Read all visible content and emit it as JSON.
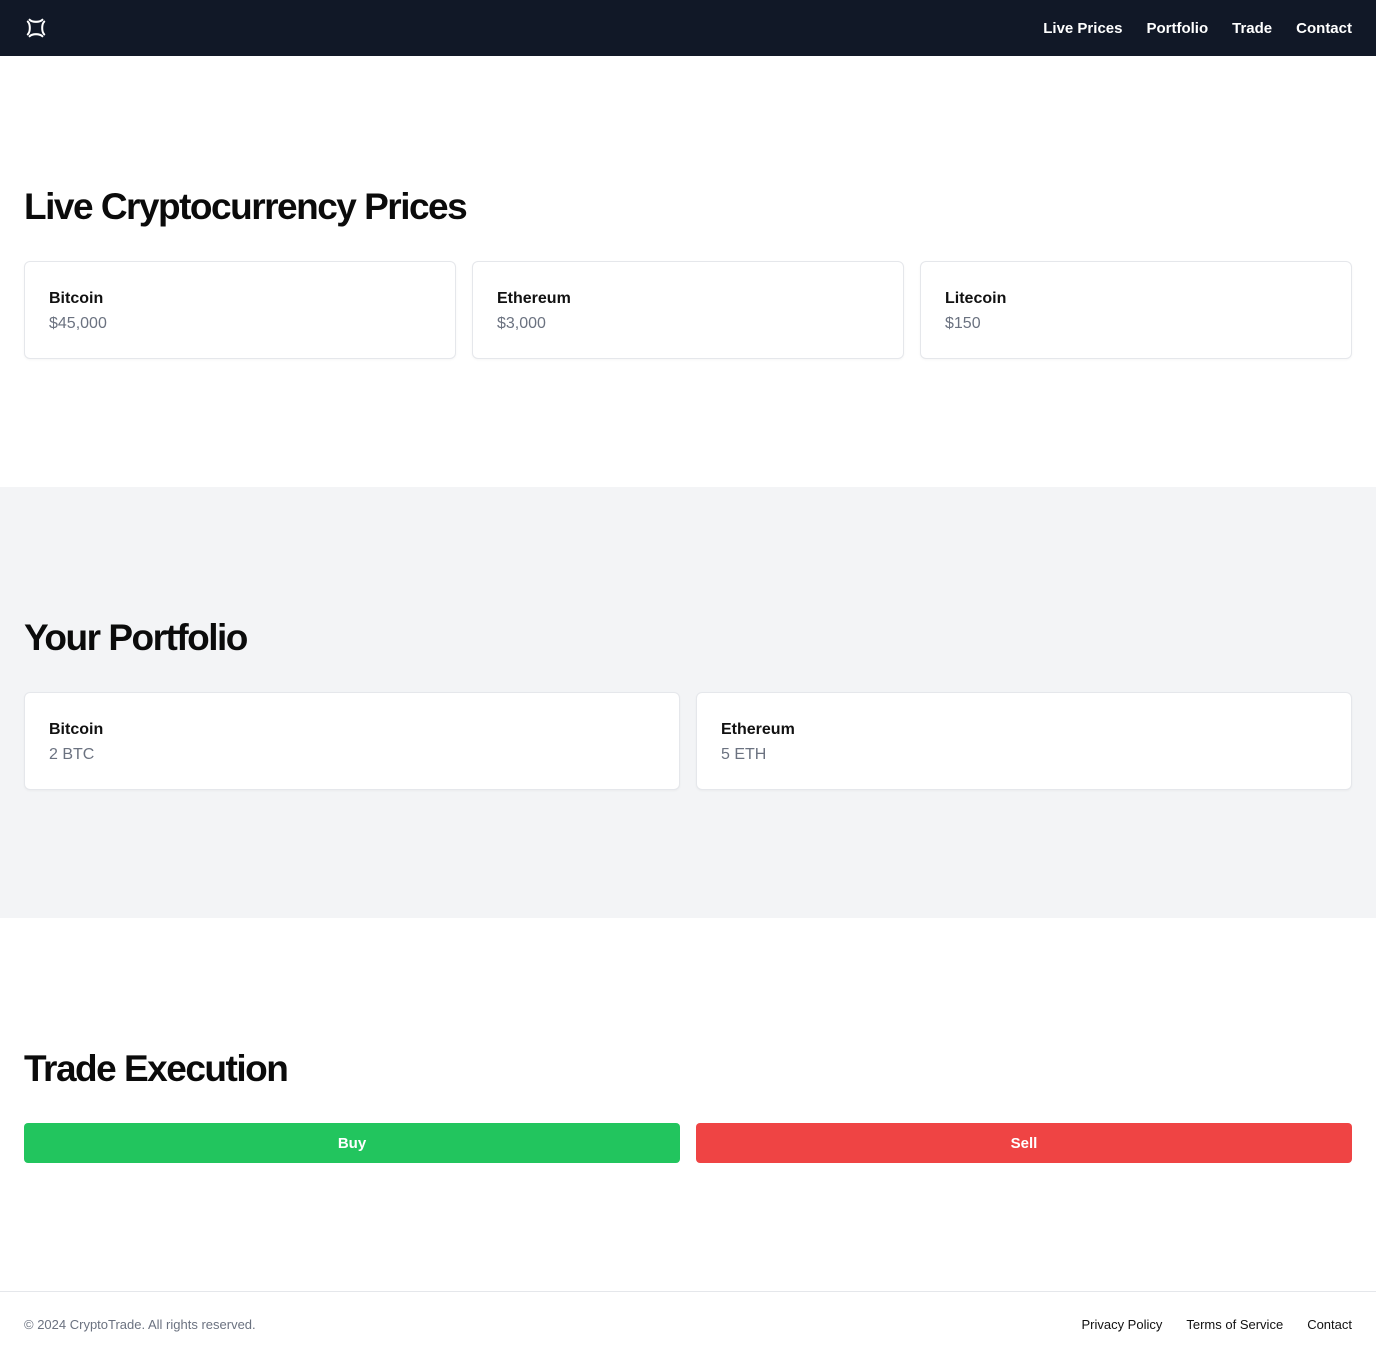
{
  "header": {
    "logo_icon": "brand-logo-icon",
    "nav": [
      {
        "label": "Live Prices"
      },
      {
        "label": "Portfolio"
      },
      {
        "label": "Trade"
      },
      {
        "label": "Contact"
      }
    ]
  },
  "prices": {
    "title": "Live Cryptocurrency Prices",
    "items": [
      {
        "name": "Bitcoin",
        "value": "$45,000"
      },
      {
        "name": "Ethereum",
        "value": "$3,000"
      },
      {
        "name": "Litecoin",
        "value": "$150"
      }
    ]
  },
  "portfolio": {
    "title": "Your Portfolio",
    "items": [
      {
        "name": "Bitcoin",
        "value": "2 BTC"
      },
      {
        "name": "Ethereum",
        "value": "5 ETH"
      }
    ]
  },
  "trade": {
    "title": "Trade Execution",
    "buy_label": "Buy",
    "sell_label": "Sell",
    "buy_color": "#22c55e",
    "sell_color": "#ef4444"
  },
  "footer": {
    "copyright": "© 2024 CryptoTrade. All rights reserved.",
    "links": [
      {
        "label": "Privacy Policy"
      },
      {
        "label": "Terms of Service"
      },
      {
        "label": "Contact"
      }
    ]
  }
}
